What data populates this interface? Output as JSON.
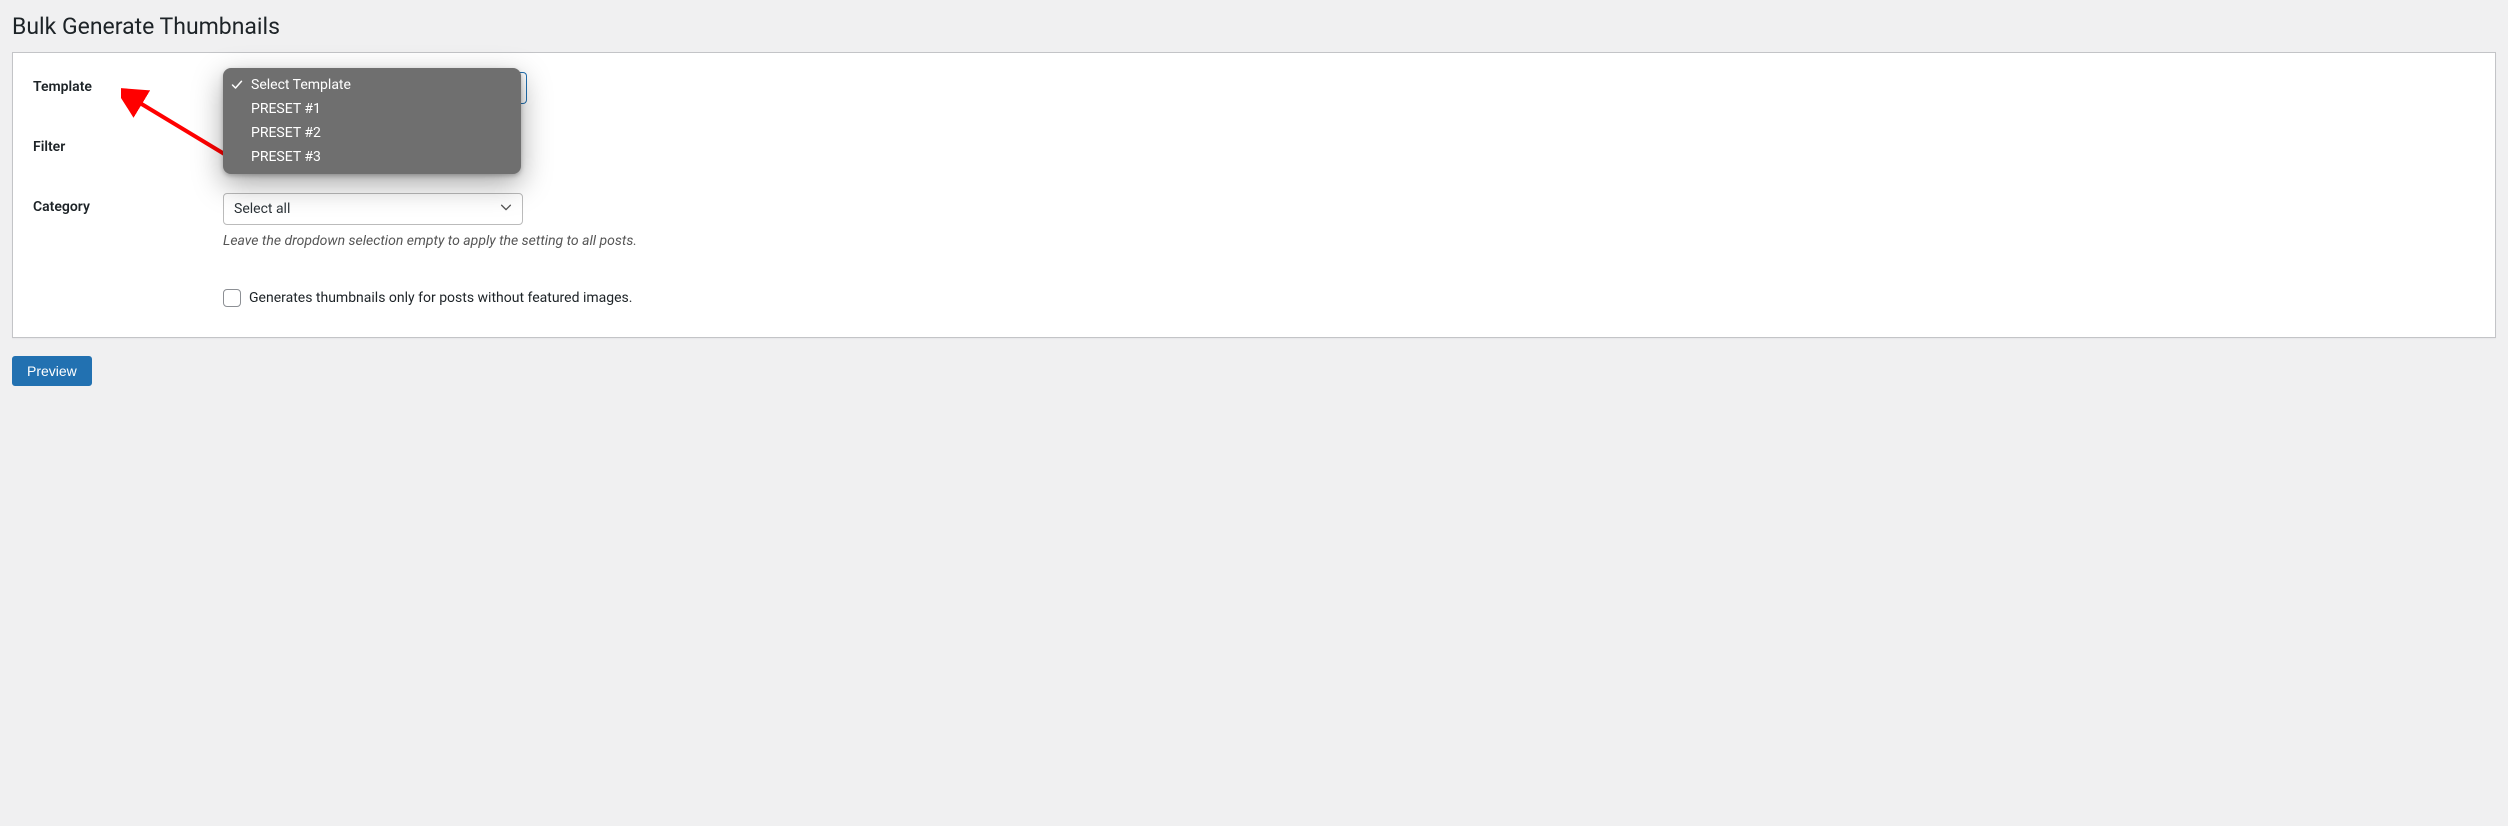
{
  "page": {
    "title": "Bulk Generate Thumbnails"
  },
  "form": {
    "template": {
      "label": "Template",
      "options": [
        "Select Template",
        "PRESET #1",
        "PRESET #2",
        "PRESET #3"
      ],
      "selected": "Select Template"
    },
    "filter": {
      "label": "Filter"
    },
    "category": {
      "label": "Category",
      "selected": "Select all",
      "helper": "Leave the dropdown selection empty to apply the setting to all posts."
    },
    "only_without_featured": {
      "label": "Generates thumbnails only for posts without featured images.",
      "checked": false
    }
  },
  "actions": {
    "preview": "Preview"
  }
}
